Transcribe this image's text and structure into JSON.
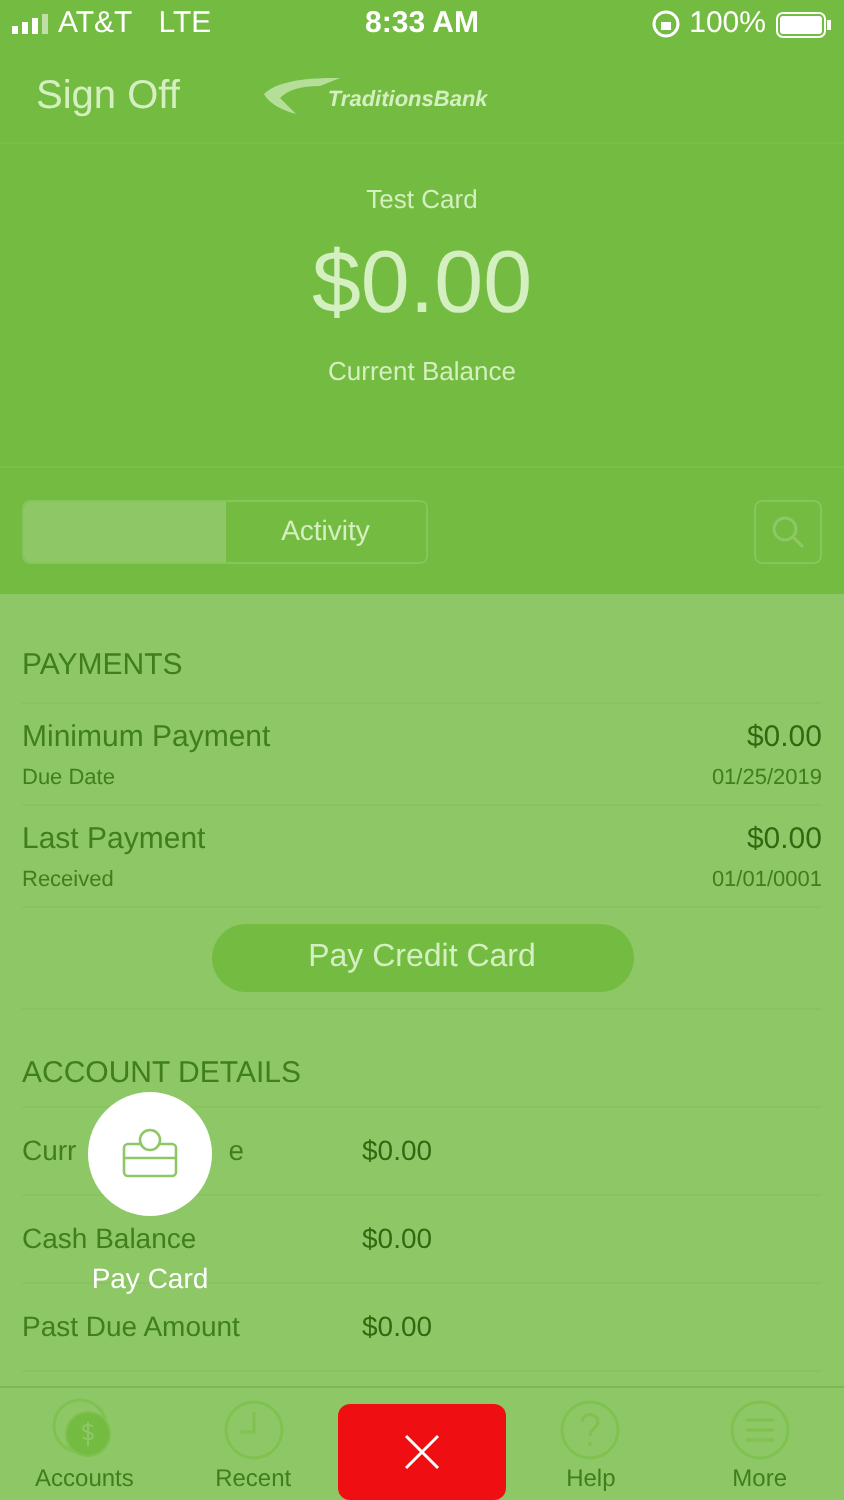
{
  "status_bar": {
    "carrier": "AT&T",
    "network": "LTE",
    "time": "8:33 AM",
    "battery": "100%"
  },
  "header": {
    "sign_off": "Sign Off",
    "logo_text": "TraditionsBank"
  },
  "balance": {
    "card_name": "Test Card",
    "amount": "$0.00",
    "caption": "Current Balance"
  },
  "tabs": [
    {
      "selected": true
    },
    {
      "label": "Activity",
      "selected": false
    }
  ],
  "payments": {
    "title": "PAYMENTS",
    "rows": [
      {
        "label": "Minimum Payment",
        "sublabel": "Due Date",
        "amount": "$0.00",
        "date": "01/25/2019"
      },
      {
        "label": "Last Payment",
        "sublabel": "Received",
        "amount": "$0.00",
        "date": "01/01/0001"
      }
    ],
    "button": "Pay Credit Card"
  },
  "account_details": {
    "title": "ACCOUNT DETAILS",
    "rows": [
      {
        "label_start": "Curr",
        "label_end": "e",
        "amount": "$0.00"
      },
      {
        "label": "Cash Balance",
        "amount": "$0.00"
      },
      {
        "label": "Past Due Amount",
        "amount": "$0.00"
      }
    ]
  },
  "fab": {
    "label": "Pay Card"
  },
  "nav": [
    {
      "label": "Accounts",
      "kind": "accounts",
      "selected": true
    },
    {
      "label": "Recent",
      "kind": "recent",
      "selected": false
    },
    {
      "kind": "close",
      "selected": false
    },
    {
      "label": "Help",
      "kind": "help",
      "selected": false
    },
    {
      "label": "More",
      "kind": "more",
      "selected": false
    }
  ]
}
